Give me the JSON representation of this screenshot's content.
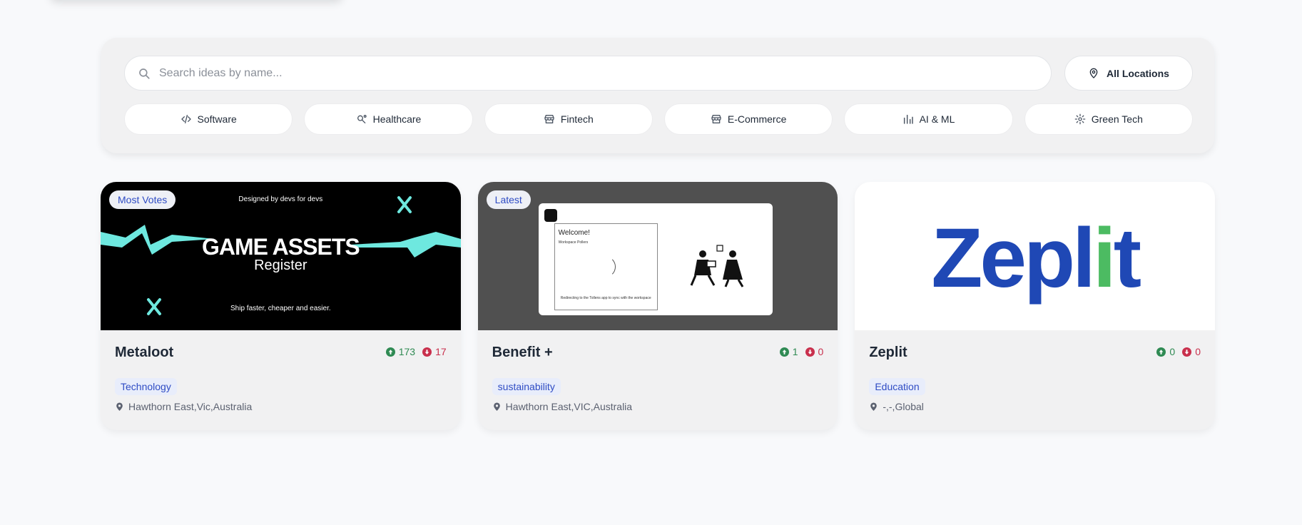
{
  "search": {
    "placeholder": "Search ideas by name..."
  },
  "location_filter": {
    "label": "All Locations"
  },
  "categories": [
    {
      "label": "Software",
      "icon": "code-icon"
    },
    {
      "label": "Healthcare",
      "icon": "stethoscope-icon"
    },
    {
      "label": "Fintech",
      "icon": "store-icon"
    },
    {
      "label": "E-Commerce",
      "icon": "store-icon"
    },
    {
      "label": "AI & ML",
      "icon": "bar-chart-icon"
    },
    {
      "label": "Green Tech",
      "icon": "gear-icon"
    }
  ],
  "cards": [
    {
      "badge": "Most Votes",
      "title": "Metaloot",
      "upvotes": "173",
      "downvotes": "17",
      "tag": "Technology",
      "location": "Hawthorn East,Vic,Australia",
      "image": {
        "tagline_top": "Designed by devs for devs",
        "title": "GAME ASSETS",
        "subtitle": "Register",
        "tagline_bottom": "Ship faster, cheaper and easier."
      }
    },
    {
      "badge": "Latest",
      "title": "Benefit +",
      "upvotes": "1",
      "downvotes": "0",
      "tag": "sustainability",
      "location": "Hawthorn East,VIC,Australia",
      "image": {
        "welcome": "Welcome!",
        "workspace": "Workspace Pollers",
        "note": "Redirecting to the Tollens app to sync with the workspace"
      }
    },
    {
      "badge": "",
      "title": "Zeplit",
      "upvotes": "0",
      "downvotes": "0",
      "tag": "Education",
      "location": "-,-,Global",
      "image": {
        "logo_a": "Zepl",
        "logo_b": "i",
        "logo_c": "t"
      }
    }
  ],
  "colors": {
    "accent": "#2f4cc4",
    "upvote": "#2f8a53",
    "downvote": "#c9304d",
    "game_zigzag": "#6ee8df",
    "zeplit_blue": "#1f48b5",
    "zeplit_green": "#4cbb62"
  }
}
